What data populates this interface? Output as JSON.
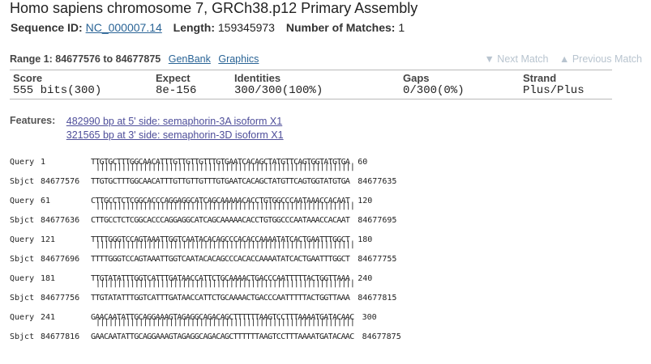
{
  "title": "Homo sapiens chromosome 7, GRCh38.p12 Primary Assembly",
  "seqinfo": {
    "seqid_label": "Sequence ID:",
    "seqid_value": "NC_000007.14",
    "length_label": "Length:",
    "length_value": "159345973",
    "matches_label": "Number of Matches:",
    "matches_value": "1"
  },
  "range": {
    "label": "Range 1: 84677576 to 84677875",
    "genbank": "GenBank",
    "graphics": "Graphics",
    "next_match": "▼ Next Match",
    "prev_match": "▲ Previous Match"
  },
  "stats": {
    "headers": [
      "Score",
      "Expect",
      "Identities",
      "Gaps",
      "Strand"
    ],
    "values": [
      "555 bits(300)",
      "8e-156",
      "300/300(100%)",
      "0/300(0%)",
      "Plus/Plus"
    ]
  },
  "features": {
    "label": "Features:",
    "links": [
      "482990 bp at 5' side: semaphorin-3A isoform X1",
      "321565 bp at 3' side: semaphorin-3D isoform X1"
    ]
  },
  "alignment": [
    {
      "q_label": "Query",
      "q_start": "1",
      "q_seq": "TTGTGCTTTGGCAACATTTGTTGTTGTTTGTGAATCACAGCTATGTTCAGTGGTATGTGA",
      "q_end": "60",
      "s_label": "Sbjct",
      "s_start": "84677576",
      "s_seq": "TTGTGCTTTGGCAACATTTGTTGTTGTTTGTGAATCACAGCTATGTTCAGTGGTATGTGA",
      "s_end": "84677635"
    },
    {
      "q_label": "Query",
      "q_start": "61",
      "q_seq": "CTTGCCTCTCGGCACCCAGGAGGCATCAGCAAAAACACCTGTGGCCCAATAAACCACAAT",
      "q_end": "120",
      "s_label": "Sbjct",
      "s_start": "84677636",
      "s_seq": "CTTGCCTCTCGGCACCCAGGAGGCATCAGCAAAAACACCTGTGGCCCAATAAACCACAAT",
      "s_end": "84677695"
    },
    {
      "q_label": "Query",
      "q_start": "121",
      "q_seq": "TTTTGGGTCCAGTAAATTGGTCAATACACAGCCCACACCAAAATATCACTGAATTTGGCT",
      "q_end": "180",
      "s_label": "Sbjct",
      "s_start": "84677696",
      "s_seq": "TTTTGGGTCCAGTAAATTGGTCAATACACAGCCCACACCAAAATATCACTGAATTTGGCT",
      "s_end": "84677755"
    },
    {
      "q_label": "Query",
      "q_start": "181",
      "q_seq": "TTGTATATTTGGTCATTTGATAACCATTCTGCAAAACTGACCCAATTTTTACTGGTTAAA",
      "q_end": "240",
      "s_label": "Sbjct",
      "s_start": "84677756",
      "s_seq": "TTGTATATTTGGTCATTTGATAACCATTCTGCAAAACTGACCCAATTTTTACTGGTTAAA",
      "s_end": "84677815"
    },
    {
      "q_label": "Query",
      "q_start": "241",
      "q_seq": "GAACAATATTGCAGGAAAGTAGAGGCAGACAGCTTTTTTAAGTCCTTTAAAATGATACAAC",
      "q_end": "300",
      "s_label": "Sbjct",
      "s_start": "84677816",
      "s_seq": "GAACAATATTGCAGGAAAGTAGAGGCAGACAGCTTTTTTAAGTCCTTTAAAATGATACAAC",
      "s_end": "84677875"
    }
  ]
}
